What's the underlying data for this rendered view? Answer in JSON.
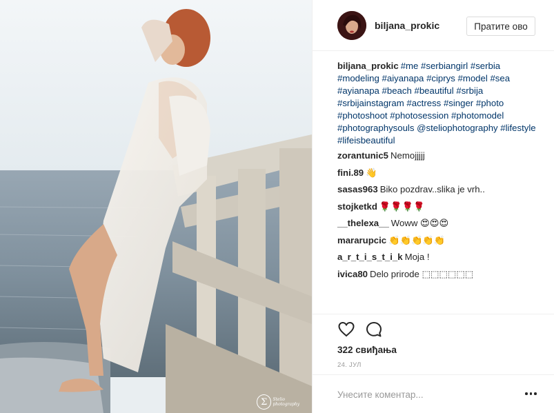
{
  "post": {
    "watermark_text": "Stelio photography",
    "watermark_logo": "Σ"
  },
  "header": {
    "username": "biljana_prokic",
    "follow_label": "Пратите ово"
  },
  "caption": {
    "username": "biljana_prokic",
    "tags": [
      "#me",
      "#serbiangirl",
      "#serbia",
      "#modeling",
      "#aiyanapa",
      "#ciprys",
      "#model",
      "#sea",
      "#ayianapa",
      "#beach",
      "#beautiful",
      "#srbija",
      "#srbijainstagram",
      "#actress",
      "#singer",
      "#photo",
      "#photoshoot",
      "#photosession",
      "#photomodel",
      "#photographysouls",
      "@steliophotography",
      "#lifestyle",
      "#lifeisbeautiful"
    ]
  },
  "comments": [
    {
      "user": "zorantunic5",
      "text": "Nemojjjjj"
    },
    {
      "user": "fini.89",
      "text": "👋"
    },
    {
      "user": "sasas963",
      "text": "Biko pozdrav..slika je vrh.."
    },
    {
      "user": "stojketkd",
      "text": "🌹🌹🌹🌹"
    },
    {
      "user": "__thelexa__",
      "text": "Woww 😍😍😍"
    },
    {
      "user": "mararupcic",
      "text": "👏👏👏👏👏"
    },
    {
      "user": "a_r_t_i_s_t_i_k",
      "text": "Moja !"
    },
    {
      "user": "ivica80",
      "text": "Delo prirode ⬚⬚⬚⬚⬚⬚"
    }
  ],
  "actions": {
    "like_icon": "heart-outline-icon",
    "comment_icon": "speech-bubble-icon",
    "likes_text": "322 свиђања",
    "date_text": "24. ЈУЛ"
  },
  "add_comment": {
    "placeholder": "Унесите коментар...",
    "more_icon": "ellipsis-icon"
  },
  "colors": {
    "hashtag": "#003569",
    "text": "#262626",
    "muted": "#999999",
    "divider": "#efefef"
  }
}
